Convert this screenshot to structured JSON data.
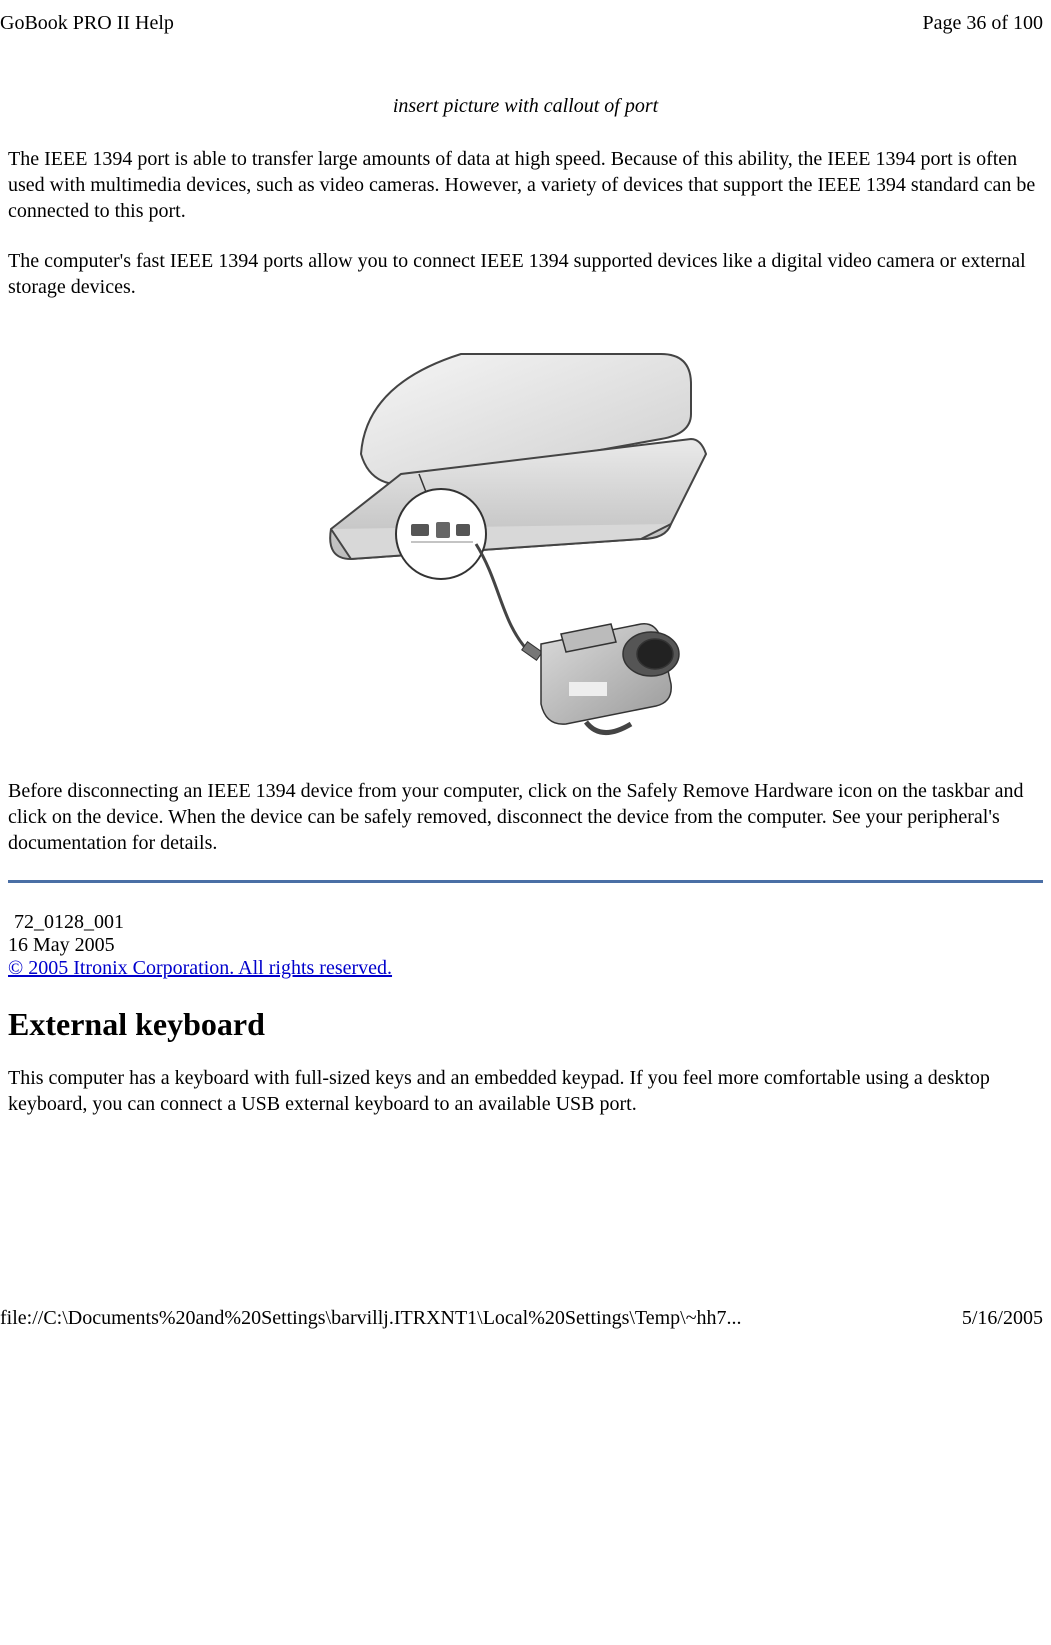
{
  "header": {
    "left": "GoBook PRO II Help",
    "right": "Page 36 of 100"
  },
  "caption": "insert picture with callout of port",
  "para1": "The IEEE 1394 port is able to transfer large amounts of data at high speed.  Because of this ability, the IEEE 1394 port is often used with multimedia devices, such as video cameras. However, a variety of devices that  support the IEEE 1394 standard can be connected to this port.",
  "para2": "The computer's fast IEEE 1394 ports allow you to connect IEEE 1394 supported devices like a digital video camera or external storage devices.",
  "para3": "Before disconnecting an IEEE 1394 device from your computer, click on the Safely Remove Hardware icon on the taskbar and click on the device. When the device can be safely removed, disconnect the device from the computer. See your peripheral's documentation for details.",
  "docid": " 72_0128_001",
  "docdate": "16 May 2005",
  "copyright": "© 2005 Itronix Corporation.  All rights reserved.",
  "section_title": "External keyboard",
  "para4": "This computer has a keyboard with full-sized keys and an embedded keypad. If you feel more comfortable using a desktop keyboard, you can connect a USB external keyboard to an available USB port.",
  "footer": {
    "left": "file://C:\\Documents%20and%20Settings\\barvillj.ITRXNT1\\Local%20Settings\\Temp\\~hh7...",
    "right": "5/16/2005"
  }
}
